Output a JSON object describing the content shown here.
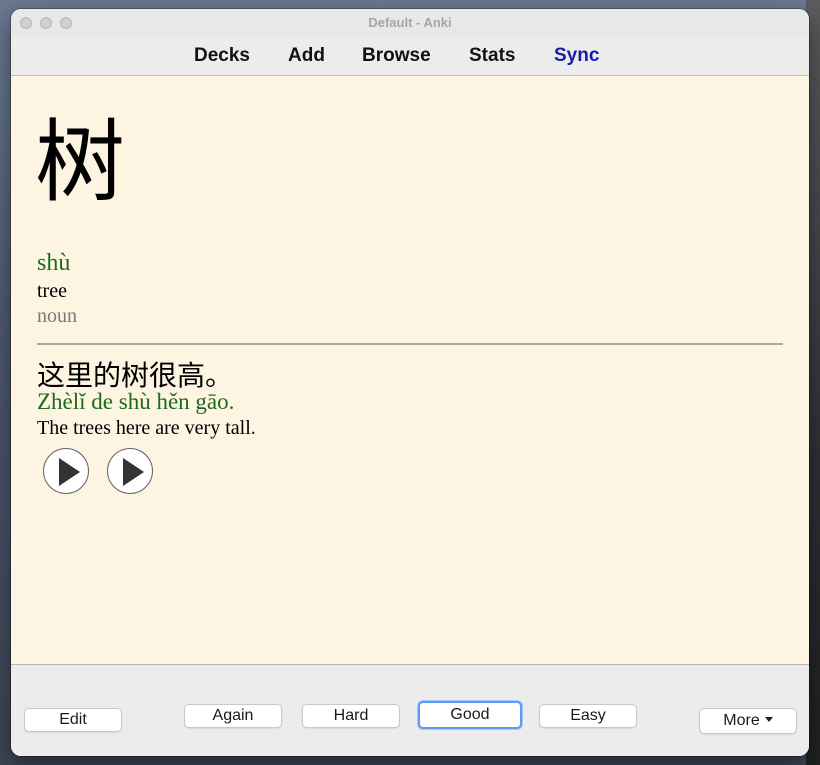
{
  "window": {
    "title": "Default - Anki"
  },
  "toolbar": {
    "items": [
      {
        "label": "Decks"
      },
      {
        "label": "Add"
      },
      {
        "label": "Browse"
      },
      {
        "label": "Stats"
      },
      {
        "label": "Sync"
      }
    ]
  },
  "card": {
    "character": "树",
    "pinyin": "shù",
    "meaning": "tree",
    "part_of_speech": "noun",
    "sentence": "这里的树很高。",
    "sentence_pinyin": "Zhèlǐ de shù hěn gāo.",
    "sentence_translation": "The trees here are very tall."
  },
  "actions": {
    "edit": "Edit",
    "again": "Again",
    "hard": "Hard",
    "good": "Good",
    "easy": "Easy",
    "more": "More"
  },
  "colors": {
    "card_background": "#fdf5e2",
    "pinyin": "#1c6b1c",
    "sync_link": "#1a1aa8",
    "focus_ring": "#5b9cf0"
  }
}
